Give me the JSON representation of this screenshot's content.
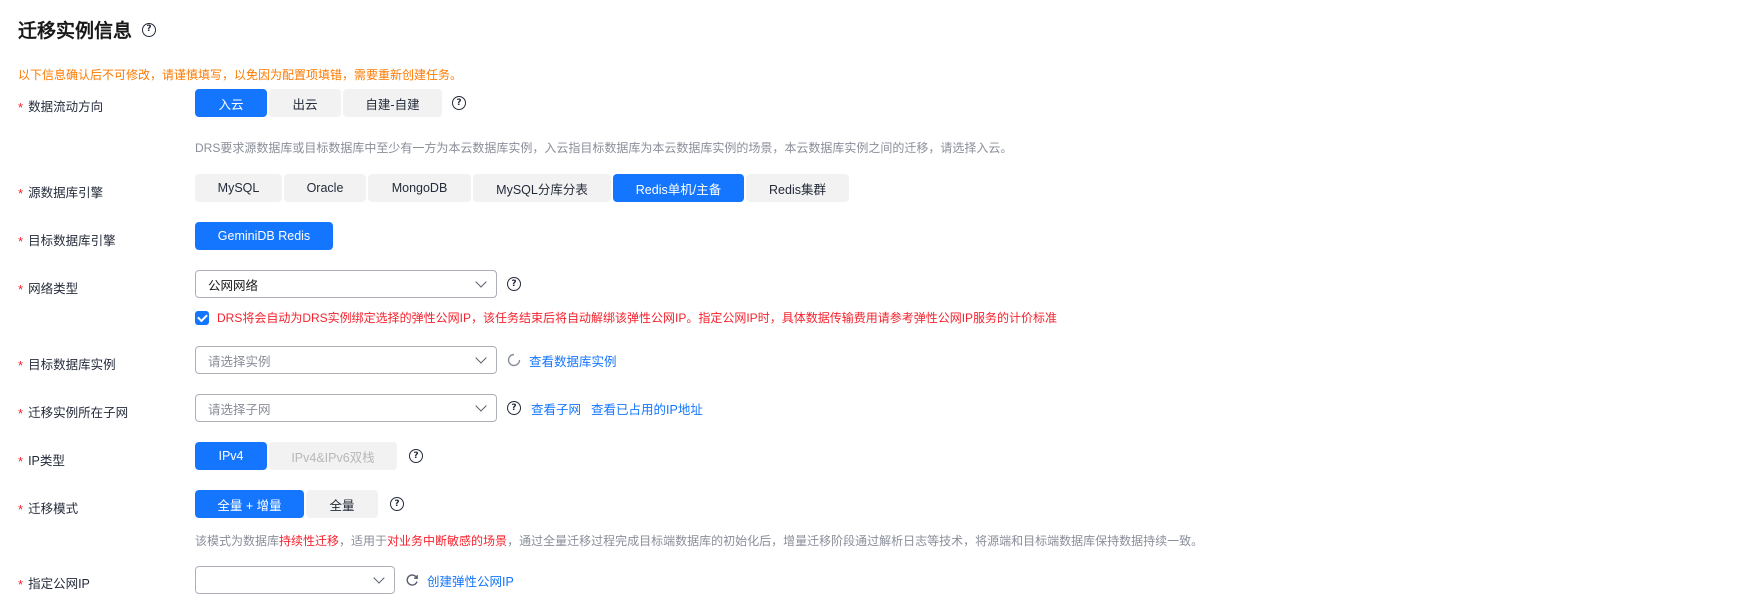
{
  "page": {
    "title": "迁移实例信息",
    "warning": "以下信息确认后不可修改，请谨慎填写，以免因为配置项填错，需要重新创建任务。"
  },
  "fields": {
    "direction": {
      "label": "数据流动方向",
      "options": [
        "入云",
        "出云",
        "自建-自建"
      ],
      "selected": "入云",
      "hint": "DRS要求源数据库或目标数据库中至少有一方为本云数据库实例，入云指目标数据库为本云数据库实例的场景，本云数据库实例之间的迁移，请选择入云。"
    },
    "source_engine": {
      "label": "源数据库引擎",
      "options": [
        "MySQL",
        "Oracle",
        "MongoDB",
        "MySQL分库分表",
        "Redis单机/主备",
        "Redis集群"
      ],
      "selected": "Redis单机/主备"
    },
    "target_engine": {
      "label": "目标数据库引擎",
      "options": [
        "GeminiDB Redis"
      ],
      "selected": "GeminiDB Redis"
    },
    "network": {
      "label": "网络类型",
      "value": "公网网络",
      "checkbox_checked": true,
      "checkbox_text": "DRS将会自动为DRS实例绑定选择的弹性公网IP，该任务结束后将自动解绑该弹性公网IP。指定公网IP时，具体数据传输费用请参考弹性公网IP服务的计价标准"
    },
    "target_instance": {
      "label": "目标数据库实例",
      "placeholder": "请选择实例",
      "link": "查看数据库实例"
    },
    "subnet": {
      "label": "迁移实例所在子网",
      "placeholder": "请选择子网",
      "link1": "查看子网",
      "link2": "查看已占用的IP地址"
    },
    "ip_type": {
      "label": "IP类型",
      "options": [
        "IPv4",
        "IPv4&IPv6双栈"
      ],
      "selected": "IPv4"
    },
    "mode": {
      "label": "迁移模式",
      "options": [
        "全量 + 增量",
        "全量"
      ],
      "selected": "全量 + 增量",
      "hint_p1": "该模式为数据库",
      "hint_em1": "持续性迁移",
      "hint_p2": "，适用于",
      "hint_em2": "对业务中断敏感的场景",
      "hint_p3": "，通过全量迁移过程完成目标端数据库的初始化后，增量迁移阶段通过解析日志等技术，将源端和目标端数据库保持数据持续一致。"
    },
    "public_ip": {
      "label": "指定公网IP",
      "value": "",
      "link": "创建弹性公网IP"
    }
  },
  "colors": {
    "primary": "#1476ff",
    "required": "#f5222d",
    "warning": "#ff7a00"
  }
}
